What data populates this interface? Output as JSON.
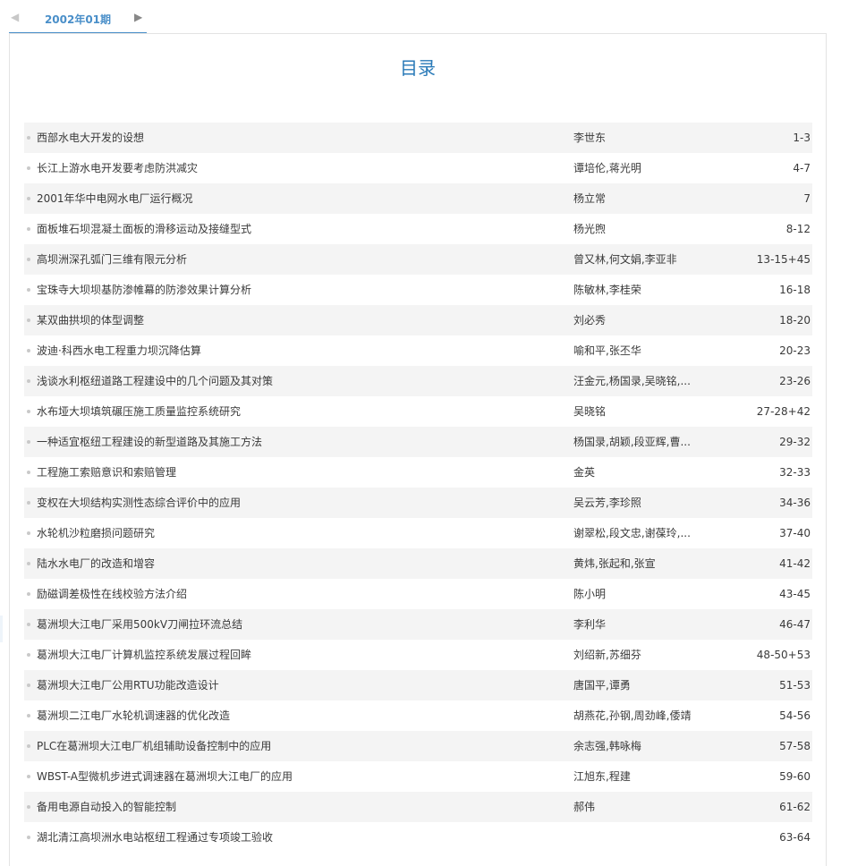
{
  "issue_nav": {
    "prev_label": "◀",
    "active_label": "2002年01期",
    "next_label": "▶"
  },
  "toc": {
    "title": "目录",
    "items": [
      {
        "title": "西部水电大开发的设想",
        "authors": "李世东",
        "pages": "1-3"
      },
      {
        "title": "长江上游水电开发要考虑防洪减灾",
        "authors": "谭培伦,蒋光明",
        "pages": "4-7"
      },
      {
        "title": "2001年华中电网水电厂运行概况",
        "authors": "杨立常",
        "pages": "7"
      },
      {
        "title": "面板堆石坝混凝土面板的滑移运动及接缝型式",
        "authors": "杨光煦",
        "pages": "8-12"
      },
      {
        "title": "高坝洲深孔弧门三维有限元分析",
        "authors": "曾又林,何文娟,李亚非",
        "pages": "13-15+45"
      },
      {
        "title": "宝珠寺大坝坝基防渗帷幕的防渗效果计算分析",
        "authors": "陈敏林,李桂荣",
        "pages": "16-18"
      },
      {
        "title": "某双曲拱坝的体型调整",
        "authors": "刘必秀",
        "pages": "18-20"
      },
      {
        "title": "波迪·科西水电工程重力坝沉降估算",
        "authors": "喻和平,张丕华",
        "pages": "20-23"
      },
      {
        "title": "浅谈水利枢纽道路工程建设中的几个问题及其对策",
        "authors": "汪金元,杨国录,吴晓铭,...",
        "pages": "23-26"
      },
      {
        "title": "水布垭大坝填筑碾压施工质量监控系统研究",
        "authors": "吴晓铭",
        "pages": "27-28+42"
      },
      {
        "title": "一种适宜枢纽工程建设的新型道路及其施工方法",
        "authors": "杨国录,胡颖,段亚辉,曹...",
        "pages": "29-32"
      },
      {
        "title": "工程施工索赔意识和索赔管理",
        "authors": "金英",
        "pages": "32-33"
      },
      {
        "title": "变权在大坝结构实测性态综合评价中的应用",
        "authors": "吴云芳,李珍照",
        "pages": "34-36"
      },
      {
        "title": "水轮机沙粒磨损问题研究",
        "authors": "谢翠松,段文忠,谢葆玲,...",
        "pages": "37-40"
      },
      {
        "title": "陆水水电厂的改造和增容",
        "authors": "黄炜,张起和,张宣",
        "pages": "41-42"
      },
      {
        "title": "励磁调差极性在线校验方法介绍",
        "authors": "陈小明",
        "pages": "43-45"
      },
      {
        "title": "葛洲坝大江电厂采用500kV刀闸拉环流总结",
        "authors": "李利华",
        "pages": "46-47"
      },
      {
        "title": "葛洲坝大江电厂计算机监控系统发展过程回眸",
        "authors": "刘绍新,苏细芬",
        "pages": "48-50+53"
      },
      {
        "title": "葛洲坝大江电厂公用RTU功能改造设计",
        "authors": "唐国平,谭勇",
        "pages": "51-53"
      },
      {
        "title": "葛洲坝二江电厂水轮机调速器的优化改造",
        "authors": "胡燕花,孙钢,周劲峰,倭靖",
        "pages": "54-56"
      },
      {
        "title": "PLC在葛洲坝大江电厂机组辅助设备控制中的应用",
        "authors": "余志强,韩咏梅",
        "pages": "57-58"
      },
      {
        "title": "WBST-A型微机步进式调速器在葛洲坝大江电厂的应用",
        "authors": "江旭东,程建",
        "pages": "59-60"
      },
      {
        "title": "备用电源自动投入的智能控制",
        "authors": "郝伟",
        "pages": "61-62"
      },
      {
        "title": "湖北清江高坝洲水电站枢纽工程通过专项竣工验收",
        "authors": "",
        "pages": "63-64"
      }
    ]
  }
}
